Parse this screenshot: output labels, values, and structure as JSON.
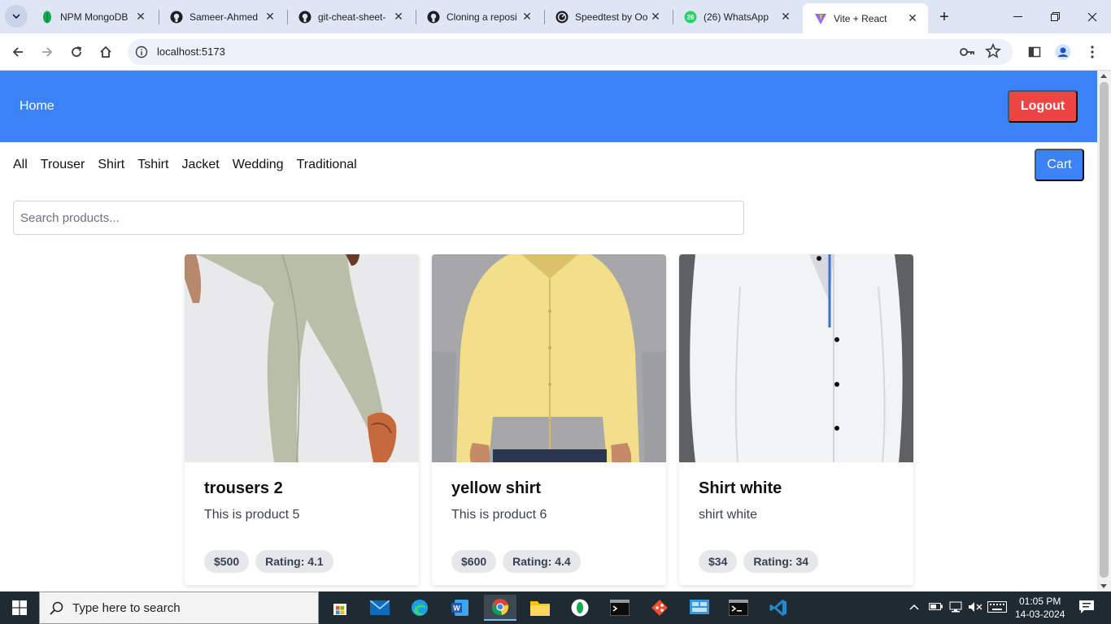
{
  "browser": {
    "tabs": [
      {
        "title": "NPM MongoDB",
        "icon": "mongodb-leaf-icon"
      },
      {
        "title": "Sameer-Ahmed",
        "icon": "github-icon"
      },
      {
        "title": "git-cheat-sheet-",
        "icon": "github-icon"
      },
      {
        "title": "Cloning a reposi",
        "icon": "github-icon"
      },
      {
        "title": "Speedtest by Oo",
        "icon": "speedtest-icon"
      },
      {
        "title": "(26) WhatsApp",
        "icon": "whatsapp-icon",
        "badge": "26"
      },
      {
        "title": "Vite + React",
        "icon": "vite-icon",
        "active": true
      }
    ],
    "url": "localhost:5173"
  },
  "navbar": {
    "home_label": "Home",
    "logout_label": "Logout",
    "color": "#3b82f6",
    "logout_color": "#ef4444"
  },
  "categories": [
    "All",
    "Trouser",
    "Shirt",
    "Tshirt",
    "Jacket",
    "Wedding",
    "Traditional"
  ],
  "cart_label": "Cart",
  "search": {
    "placeholder": "Search products..."
  },
  "products": [
    {
      "name": "trousers 2",
      "description": "This is product 5",
      "price": "$500",
      "rating": "Rating: 4.1"
    },
    {
      "name": "yellow shirt",
      "description": "This is product 6",
      "price": "$600",
      "rating": "Rating: 4.4"
    },
    {
      "name": "Shirt white",
      "description": "shirt white",
      "price": "$34",
      "rating": "Rating: 34"
    }
  ],
  "taskbar": {
    "search_placeholder": "Type here to search",
    "time": "01:05 PM",
    "date": "14-03-2024",
    "apps": [
      "microsoft-store-icon",
      "mail-icon",
      "edge-icon",
      "word-icon",
      "chrome-icon",
      "file-explorer-icon",
      "mongodb-compass-icon",
      "terminal-icon",
      "git-icon",
      "control-panel-icon",
      "cmd-icon",
      "vscode-icon"
    ]
  }
}
